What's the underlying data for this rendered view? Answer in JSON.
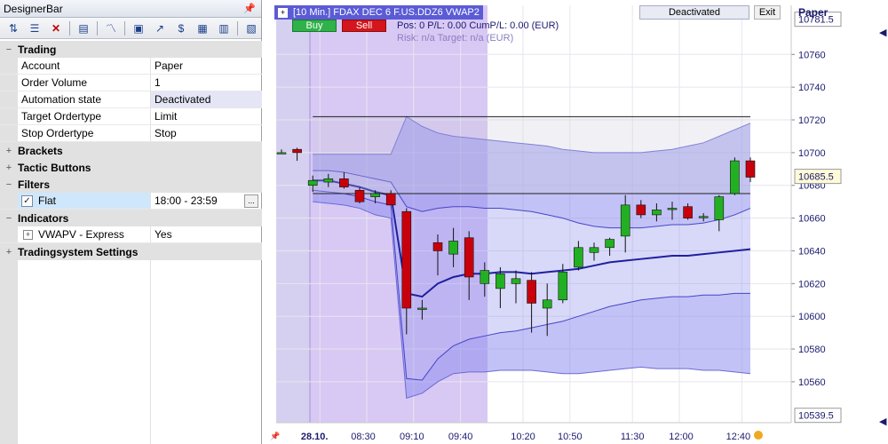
{
  "designer_bar": {
    "title": "DesignerBar",
    "pin_icon": "pin-icon",
    "toolbar_icons": [
      "sort-icon",
      "list-icon",
      "delete-icon",
      "checklist-icon",
      "chart-line-icon",
      "print-icon",
      "trend-icon",
      "dollar-icon",
      "bars-icon",
      "table-icon",
      "properties-icon"
    ],
    "categories": {
      "trading": {
        "label": "Trading",
        "toggle": "−",
        "rows": [
          {
            "key": "Account",
            "value": "Paper"
          },
          {
            "key": "Order Volume",
            "value": "1"
          },
          {
            "key": "Automation state",
            "value": "Deactivated"
          },
          {
            "key": "Target Ordertype",
            "value": "Limit"
          },
          {
            "key": "Stop Ordertype",
            "value": "Stop"
          }
        ]
      },
      "brackets": {
        "label": "Brackets",
        "toggle": "+"
      },
      "tactic": {
        "label": "Tactic Buttons",
        "toggle": "+"
      },
      "filters": {
        "label": "Filters",
        "toggle": "−",
        "row": {
          "key": "Flat",
          "value": "18:00 - 23:59",
          "checked": "✓",
          "ellipsis": "..."
        }
      },
      "indicators": {
        "label": "Indicators",
        "toggle": "−",
        "row": {
          "key": "VWAPV - Express",
          "value": "Yes",
          "expand": "+"
        }
      },
      "tradingsystem": {
        "label": "Tradingsystem Settings",
        "toggle": "+"
      }
    }
  },
  "chart": {
    "window_title": "[10 Min.] FDAX DEC 6   F.US.DDZ6 VWAP2",
    "title_box": "+",
    "buy_label": "Buy",
    "sell_label": "Sell",
    "pos_line": "Pos: 0  P/L: 0.00  CumP/L: 0.00 (EUR)",
    "risk_line": "Risk: n/a  Target: n/a (EUR)",
    "status": "Deactivated",
    "exit_label": "Exit",
    "account_label": "Paper",
    "colors": {
      "up": "#22b022",
      "down": "#c8000c",
      "vwap": "#2020a0",
      "band": "#8f8fee",
      "session": "#d6c8f2"
    },
    "chart_data": {
      "type": "candlestick",
      "ylim": [
        10535,
        10790
      ],
      "y_ticks": [
        10560,
        10580,
        10600,
        10620,
        10640,
        10660,
        10680,
        10700,
        10720,
        10740,
        10760
      ],
      "top_price_label": "10781.5",
      "current_price_label": "10685.5",
      "bottom_price_label": "10539.5",
      "x_labels": [
        "28.10.",
        "08:30",
        "09:10",
        "09:40",
        "10:20",
        "10:50",
        "11:30",
        "12:00",
        "12:40"
      ],
      "candles": [
        {
          "o": 10700,
          "h": 10702,
          "l": 10700,
          "c": 10700
        },
        {
          "o": 10702,
          "h": 10703,
          "l": 10695,
          "c": 10700
        },
        {
          "o": 10680,
          "h": 10686,
          "l": 10676,
          "c": 10683
        },
        {
          "o": 10682,
          "h": 10687,
          "l": 10679,
          "c": 10684
        },
        {
          "o": 10684,
          "h": 10688,
          "l": 10678,
          "c": 10679
        },
        {
          "o": 10677,
          "h": 10679,
          "l": 10669,
          "c": 10670
        },
        {
          "o": 10673,
          "h": 10677,
          "l": 10669,
          "c": 10675
        },
        {
          "o": 10675,
          "h": 10677,
          "l": 10669,
          "c": 10668
        },
        {
          "o": 10664,
          "h": 10666,
          "l": 10589,
          "c": 10605
        },
        {
          "o": 10605,
          "h": 10610,
          "l": 10598,
          "c": 10605
        },
        {
          "o": 10645,
          "h": 10650,
          "l": 10625,
          "c": 10640
        },
        {
          "o": 10638,
          "h": 10654,
          "l": 10630,
          "c": 10646
        },
        {
          "o": 10648,
          "h": 10652,
          "l": 10610,
          "c": 10624
        },
        {
          "o": 10620,
          "h": 10633,
          "l": 10612,
          "c": 10628
        },
        {
          "o": 10617,
          "h": 10630,
          "l": 10605,
          "c": 10626
        },
        {
          "o": 10620,
          "h": 10628,
          "l": 10608,
          "c": 10623
        },
        {
          "o": 10622,
          "h": 10627,
          "l": 10590,
          "c": 10608
        },
        {
          "o": 10605,
          "h": 10620,
          "l": 10588,
          "c": 10610
        },
        {
          "o": 10610,
          "h": 10632,
          "l": 10608,
          "c": 10627
        },
        {
          "o": 10630,
          "h": 10646,
          "l": 10628,
          "c": 10642
        },
        {
          "o": 10639,
          "h": 10645,
          "l": 10634,
          "c": 10642
        },
        {
          "o": 10642,
          "h": 10648,
          "l": 10637,
          "c": 10647
        },
        {
          "o": 10649,
          "h": 10674,
          "l": 10639,
          "c": 10668
        },
        {
          "o": 10668,
          "h": 10671,
          "l": 10660,
          "c": 10662
        },
        {
          "o": 10662,
          "h": 10669,
          "l": 10658,
          "c": 10665
        },
        {
          "o": 10666,
          "h": 10670,
          "l": 10659,
          "c": 10666
        },
        {
          "o": 10667,
          "h": 10669,
          "l": 10659,
          "c": 10660
        },
        {
          "o": 10661,
          "h": 10663,
          "l": 10658,
          "c": 10661
        },
        {
          "o": 10659,
          "h": 10674,
          "l": 10652,
          "c": 10673
        },
        {
          "o": 10675,
          "h": 10697,
          "l": 10674,
          "c": 10695
        },
        {
          "o": 10695,
          "h": 10697,
          "l": 10682,
          "c": 10685
        }
      ],
      "vwap": [
        10685,
        10684,
        10683,
        10683,
        10681,
        10679,
        10676,
        10674,
        10614,
        10612,
        10620,
        10624,
        10626,
        10626,
        10627,
        10627,
        10626,
        10627,
        10628,
        10629,
        10631,
        10633,
        10634,
        10635,
        10636,
        10637,
        10637,
        10638,
        10639,
        10640,
        10641
      ],
      "band_outer_upper": [
        10699,
        10699,
        10699,
        10699,
        10699,
        10699,
        10699,
        10699,
        10722,
        10716,
        10712,
        10710,
        10709,
        10708,
        10707,
        10706,
        10705,
        10704,
        10702,
        10701,
        10700,
        10700,
        10700,
        10700,
        10701,
        10702,
        10704,
        10706,
        10710,
        10714,
        10718
      ],
      "band_inner_upper": [
        10690,
        10690,
        10689,
        10689,
        10688,
        10686,
        10684,
        10682,
        10667,
        10664,
        10666,
        10667,
        10667,
        10666,
        10666,
        10665,
        10664,
        10662,
        10660,
        10657,
        10655,
        10654,
        10654,
        10654,
        10655,
        10656,
        10656,
        10657,
        10659,
        10662,
        10666
      ],
      "band_inner_lower": [
        10678,
        10678,
        10677,
        10676,
        10675,
        10673,
        10670,
        10668,
        10562,
        10561,
        10574,
        10582,
        10586,
        10588,
        10590,
        10591,
        10593,
        10595,
        10597,
        10600,
        10603,
        10606,
        10608,
        10610,
        10611,
        10612,
        10612,
        10613,
        10613,
        10614,
        10614
      ],
      "band_outer_lower": [
        10671,
        10671,
        10670,
        10669,
        10668,
        10666,
        10662,
        10660,
        10550,
        10553,
        10560,
        10565,
        10566,
        10566,
        10567,
        10567,
        10567,
        10566,
        10565,
        10565,
        10566,
        10567,
        10568,
        10569,
        10568,
        10568,
        10568,
        10567,
        10567,
        10566,
        10565
      ],
      "lines": [
        {
          "price": 10722,
          "label": ""
        },
        {
          "price": 10675,
          "label": ""
        }
      ]
    }
  }
}
